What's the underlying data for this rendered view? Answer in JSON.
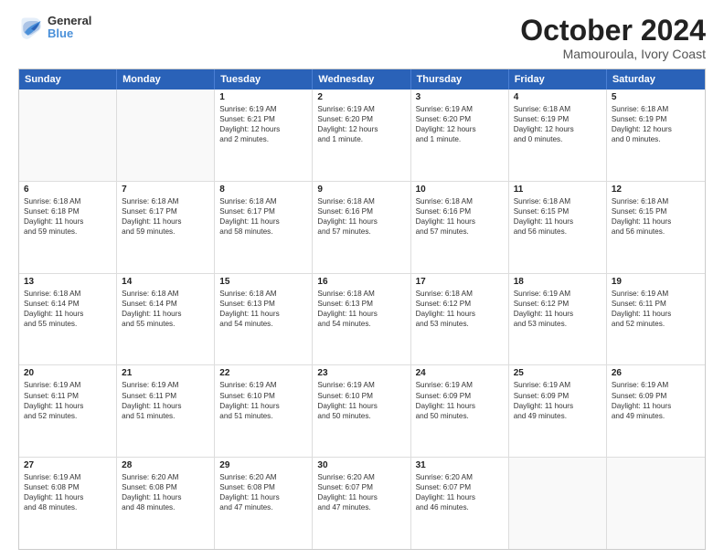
{
  "logo": {
    "line1": "General",
    "line2": "Blue"
  },
  "title": "October 2024",
  "subtitle": "Mamouroula, Ivory Coast",
  "header_days": [
    "Sunday",
    "Monday",
    "Tuesday",
    "Wednesday",
    "Thursday",
    "Friday",
    "Saturday"
  ],
  "weeks": [
    [
      {
        "day": "",
        "lines": []
      },
      {
        "day": "",
        "lines": []
      },
      {
        "day": "1",
        "lines": [
          "Sunrise: 6:19 AM",
          "Sunset: 6:21 PM",
          "Daylight: 12 hours",
          "and 2 minutes."
        ]
      },
      {
        "day": "2",
        "lines": [
          "Sunrise: 6:19 AM",
          "Sunset: 6:20 PM",
          "Daylight: 12 hours",
          "and 1 minute."
        ]
      },
      {
        "day": "3",
        "lines": [
          "Sunrise: 6:19 AM",
          "Sunset: 6:20 PM",
          "Daylight: 12 hours",
          "and 1 minute."
        ]
      },
      {
        "day": "4",
        "lines": [
          "Sunrise: 6:18 AM",
          "Sunset: 6:19 PM",
          "Daylight: 12 hours",
          "and 0 minutes."
        ]
      },
      {
        "day": "5",
        "lines": [
          "Sunrise: 6:18 AM",
          "Sunset: 6:19 PM",
          "Daylight: 12 hours",
          "and 0 minutes."
        ]
      }
    ],
    [
      {
        "day": "6",
        "lines": [
          "Sunrise: 6:18 AM",
          "Sunset: 6:18 PM",
          "Daylight: 11 hours",
          "and 59 minutes."
        ]
      },
      {
        "day": "7",
        "lines": [
          "Sunrise: 6:18 AM",
          "Sunset: 6:17 PM",
          "Daylight: 11 hours",
          "and 59 minutes."
        ]
      },
      {
        "day": "8",
        "lines": [
          "Sunrise: 6:18 AM",
          "Sunset: 6:17 PM",
          "Daylight: 11 hours",
          "and 58 minutes."
        ]
      },
      {
        "day": "9",
        "lines": [
          "Sunrise: 6:18 AM",
          "Sunset: 6:16 PM",
          "Daylight: 11 hours",
          "and 57 minutes."
        ]
      },
      {
        "day": "10",
        "lines": [
          "Sunrise: 6:18 AM",
          "Sunset: 6:16 PM",
          "Daylight: 11 hours",
          "and 57 minutes."
        ]
      },
      {
        "day": "11",
        "lines": [
          "Sunrise: 6:18 AM",
          "Sunset: 6:15 PM",
          "Daylight: 11 hours",
          "and 56 minutes."
        ]
      },
      {
        "day": "12",
        "lines": [
          "Sunrise: 6:18 AM",
          "Sunset: 6:15 PM",
          "Daylight: 11 hours",
          "and 56 minutes."
        ]
      }
    ],
    [
      {
        "day": "13",
        "lines": [
          "Sunrise: 6:18 AM",
          "Sunset: 6:14 PM",
          "Daylight: 11 hours",
          "and 55 minutes."
        ]
      },
      {
        "day": "14",
        "lines": [
          "Sunrise: 6:18 AM",
          "Sunset: 6:14 PM",
          "Daylight: 11 hours",
          "and 55 minutes."
        ]
      },
      {
        "day": "15",
        "lines": [
          "Sunrise: 6:18 AM",
          "Sunset: 6:13 PM",
          "Daylight: 11 hours",
          "and 54 minutes."
        ]
      },
      {
        "day": "16",
        "lines": [
          "Sunrise: 6:18 AM",
          "Sunset: 6:13 PM",
          "Daylight: 11 hours",
          "and 54 minutes."
        ]
      },
      {
        "day": "17",
        "lines": [
          "Sunrise: 6:18 AM",
          "Sunset: 6:12 PM",
          "Daylight: 11 hours",
          "and 53 minutes."
        ]
      },
      {
        "day": "18",
        "lines": [
          "Sunrise: 6:19 AM",
          "Sunset: 6:12 PM",
          "Daylight: 11 hours",
          "and 53 minutes."
        ]
      },
      {
        "day": "19",
        "lines": [
          "Sunrise: 6:19 AM",
          "Sunset: 6:11 PM",
          "Daylight: 11 hours",
          "and 52 minutes."
        ]
      }
    ],
    [
      {
        "day": "20",
        "lines": [
          "Sunrise: 6:19 AM",
          "Sunset: 6:11 PM",
          "Daylight: 11 hours",
          "and 52 minutes."
        ]
      },
      {
        "day": "21",
        "lines": [
          "Sunrise: 6:19 AM",
          "Sunset: 6:11 PM",
          "Daylight: 11 hours",
          "and 51 minutes."
        ]
      },
      {
        "day": "22",
        "lines": [
          "Sunrise: 6:19 AM",
          "Sunset: 6:10 PM",
          "Daylight: 11 hours",
          "and 51 minutes."
        ]
      },
      {
        "day": "23",
        "lines": [
          "Sunrise: 6:19 AM",
          "Sunset: 6:10 PM",
          "Daylight: 11 hours",
          "and 50 minutes."
        ]
      },
      {
        "day": "24",
        "lines": [
          "Sunrise: 6:19 AM",
          "Sunset: 6:09 PM",
          "Daylight: 11 hours",
          "and 50 minutes."
        ]
      },
      {
        "day": "25",
        "lines": [
          "Sunrise: 6:19 AM",
          "Sunset: 6:09 PM",
          "Daylight: 11 hours",
          "and 49 minutes."
        ]
      },
      {
        "day": "26",
        "lines": [
          "Sunrise: 6:19 AM",
          "Sunset: 6:09 PM",
          "Daylight: 11 hours",
          "and 49 minutes."
        ]
      }
    ],
    [
      {
        "day": "27",
        "lines": [
          "Sunrise: 6:19 AM",
          "Sunset: 6:08 PM",
          "Daylight: 11 hours",
          "and 48 minutes."
        ]
      },
      {
        "day": "28",
        "lines": [
          "Sunrise: 6:20 AM",
          "Sunset: 6:08 PM",
          "Daylight: 11 hours",
          "and 48 minutes."
        ]
      },
      {
        "day": "29",
        "lines": [
          "Sunrise: 6:20 AM",
          "Sunset: 6:08 PM",
          "Daylight: 11 hours",
          "and 47 minutes."
        ]
      },
      {
        "day": "30",
        "lines": [
          "Sunrise: 6:20 AM",
          "Sunset: 6:07 PM",
          "Daylight: 11 hours",
          "and 47 minutes."
        ]
      },
      {
        "day": "31",
        "lines": [
          "Sunrise: 6:20 AM",
          "Sunset: 6:07 PM",
          "Daylight: 11 hours",
          "and 46 minutes."
        ]
      },
      {
        "day": "",
        "lines": []
      },
      {
        "day": "",
        "lines": []
      }
    ]
  ]
}
